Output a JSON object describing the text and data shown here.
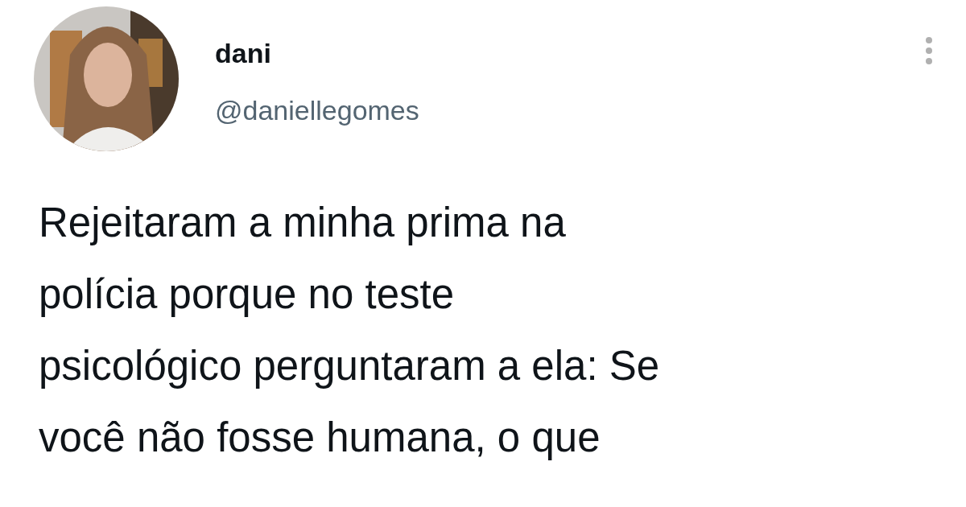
{
  "tweet": {
    "display_name": "dani",
    "handle": "@daniellegomes",
    "text_lines": [
      "Rejeitaram a minha prima na",
      "polícia porque no teste",
      "psicológico perguntaram a ela: Se",
      "você não fosse humana, o que"
    ]
  }
}
